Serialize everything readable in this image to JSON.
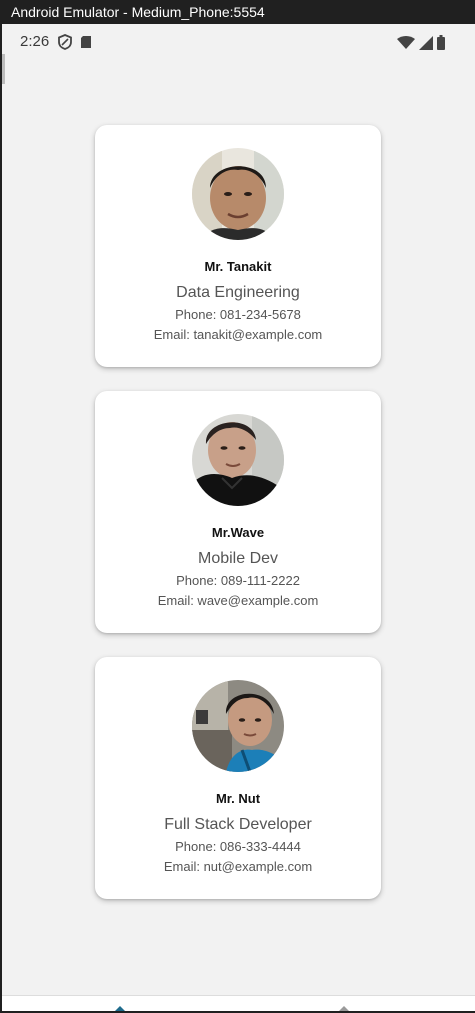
{
  "window": {
    "title": "Android Emulator - Medium_Phone:5554"
  },
  "status_bar": {
    "time": "2:26",
    "icons_left": [
      "shield-icon",
      "sd-card-icon"
    ],
    "icons_right": [
      "wifi-icon",
      "cellular-signal-icon",
      "battery-icon"
    ]
  },
  "colors": {
    "screen_background": "#f2f2f2",
    "card_background": "#ffffff",
    "name_text": "#111111",
    "secondary_text": "#555555",
    "nav_accent": "#1e6b8c"
  },
  "cards": [
    {
      "name": "Mr. Tanakit",
      "role": "Data Engineering",
      "phone": "Phone: 081-234-5678",
      "email": "Email: tanakit@example.com",
      "avatar": "profile-photo"
    },
    {
      "name": "Mr.Wave",
      "role": "Mobile Dev",
      "phone": "Phone: 089-111-2222",
      "email": "Email: wave@example.com",
      "avatar": "profile-photo"
    },
    {
      "name": "Mr. Nut",
      "role": "Full Stack Developer",
      "phone": "Phone: 086-333-4444",
      "email": "Email: nut@example.com",
      "avatar": "profile-photo"
    }
  ],
  "bottom_nav": {
    "items": [
      "nav-item-home",
      "nav-item-next"
    ]
  }
}
